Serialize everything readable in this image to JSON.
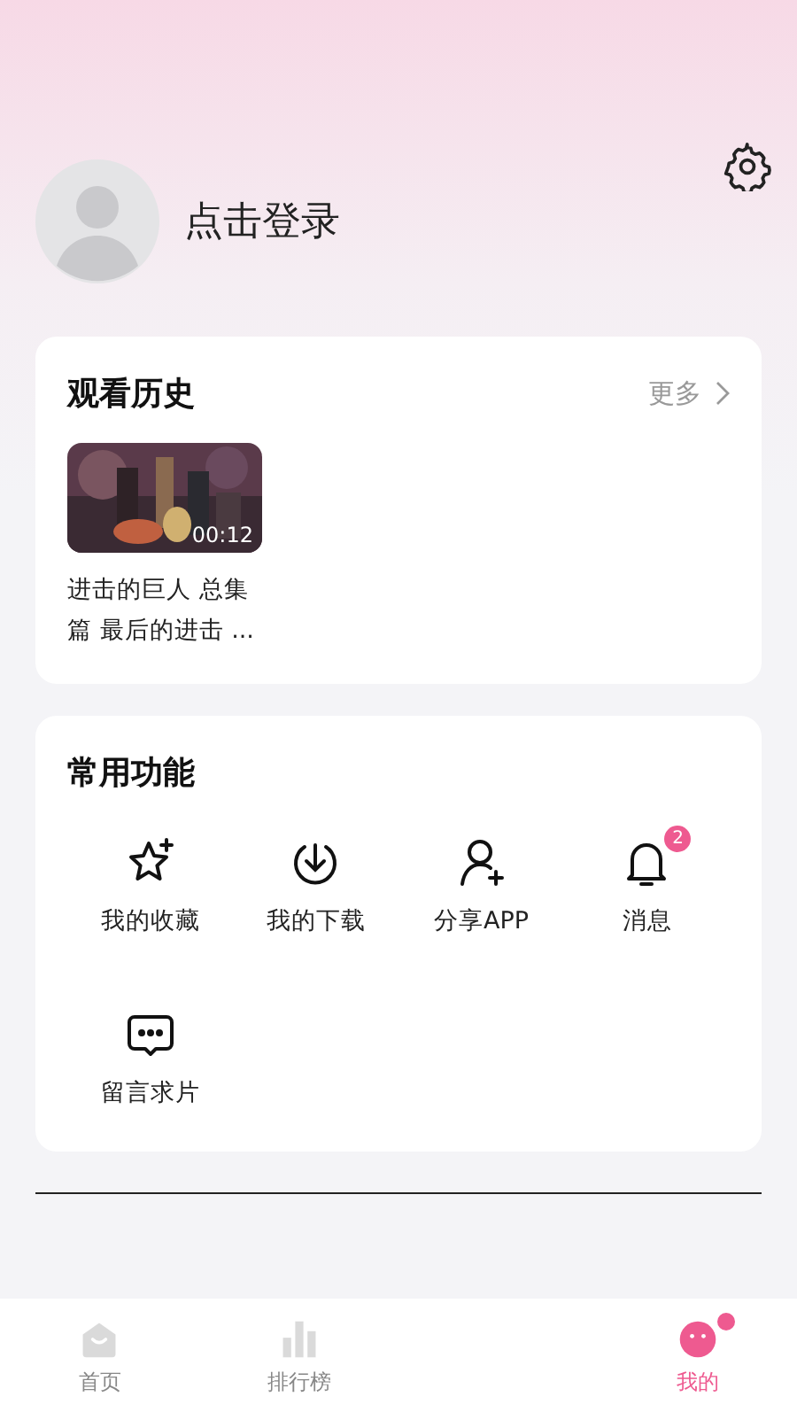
{
  "profile": {
    "login_label": "点击登录"
  },
  "history": {
    "title": "观看历史",
    "more": "更多",
    "items": [
      {
        "kind": "picture",
        "duration": "00:12",
        "title": "进击的巨人 总集篇 最后的进击 ..."
      }
    ]
  },
  "functions": {
    "title": "常用功能",
    "items": [
      {
        "kind": "star",
        "label": "我的收藏"
      },
      {
        "kind": "download",
        "label": "我的下载"
      },
      {
        "kind": "share",
        "label": "分享APP"
      },
      {
        "kind": "bell",
        "label": "消息",
        "badge": "2"
      },
      {
        "kind": "message",
        "label": "留言求片"
      }
    ]
  },
  "tabbar": [
    {
      "kind": "home",
      "label": "首页",
      "selected": false,
      "dot": false
    },
    {
      "kind": "rank",
      "label": "排行榜",
      "selected": false,
      "dot": false
    },
    {
      "kind": "mine",
      "label": "我的",
      "selected": true,
      "dot": true
    }
  ]
}
